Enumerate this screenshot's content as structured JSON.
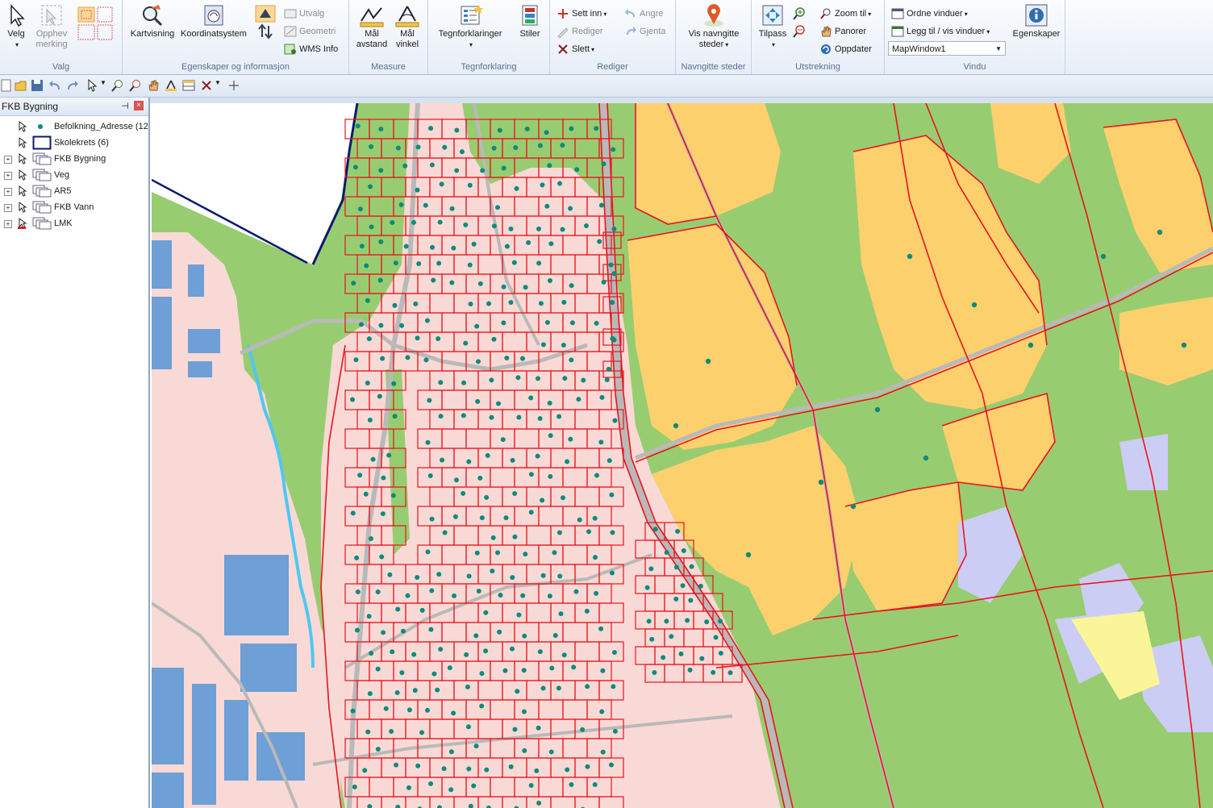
{
  "ribbon": {
    "groups": {
      "valg": "Valg",
      "egenskaper": "Egenskaper og informasjon",
      "measure": "Measure",
      "tegnforklaring": "Tegnforklaring",
      "rediger": "Rediger",
      "navngitte": "Navngitte steder",
      "utstrekning": "Utstrekning",
      "vindu": "Vindu"
    },
    "velg": "Velg",
    "opphev_1": "Opphev",
    "opphev_2": "merking",
    "kartvisning": "Kartvisning",
    "koordinatsystem": "Koordinatsystem",
    "utvalg": "Utvalg",
    "geometri": "Geometri",
    "wms_info": "WMS Info",
    "maal_avstand_1": "Mål",
    "maal_avstand_2": "avstand",
    "maal_vinkel_1": "Mål",
    "maal_vinkel_2": "vinkel",
    "tegnforklaringer": "Tegnforklaringer",
    "stiler": "Stiler",
    "sett_inn": "Sett inn",
    "rediger_btn": "Rediger",
    "slett": "Slett",
    "angre": "Angre",
    "gjenta": "Gjenta",
    "vis_navngitte_1": "Vis navngitte",
    "vis_navngitte_2": "steder",
    "tilpass": "Tilpass",
    "zoom_til": "Zoom til",
    "panorer": "Panorer",
    "oppdater": "Oppdater",
    "ordne_vinduer": "Ordne vinduer",
    "legg_til_vinduer": "Legg til / vis vinduer",
    "mapwindow": "MapWindow1",
    "egenskaper_btn": "Egenskaper"
  },
  "panel": {
    "title": "FKB Bygning",
    "layers": [
      {
        "label": "Befolkning_Adresse (12"
      },
      {
        "label": "Skolekrets (6)"
      },
      {
        "label": "FKB Bygning"
      },
      {
        "label": "Veg"
      },
      {
        "label": "AR5"
      },
      {
        "label": "FKB Vann"
      },
      {
        "label": "LMK"
      }
    ]
  },
  "colors": {
    "residential": "#f9d9d6",
    "cadastre": "#e8141c",
    "farmland": "#fdd06e",
    "grass": "#98cc71",
    "forest": "#a6d68a",
    "road": "#b9b9b9",
    "water": "#4fc7f0",
    "industrial": "#6e9fd6",
    "address": "#0f8a7a",
    "wetland": "#cccdf5"
  }
}
